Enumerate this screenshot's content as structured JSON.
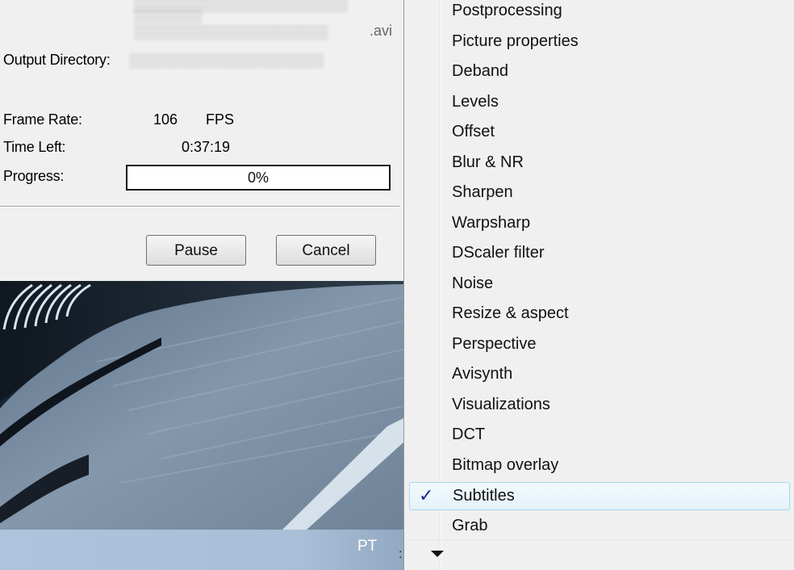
{
  "dialog": {
    "input_file_ext": ".avi",
    "output_directory_label": "Output Directory:",
    "frame_rate_label": "Frame Rate:",
    "frame_rate_value": "106",
    "frame_rate_unit": "FPS",
    "time_left_label": "Time Left:",
    "time_left_value": "0:37:19",
    "progress_label": "Progress:",
    "progress_text": "0%",
    "progress_fraction": 0,
    "pause_label": "Pause",
    "cancel_label": "Cancel"
  },
  "taskbar": {
    "language": "PT"
  },
  "menu": {
    "items": [
      {
        "label": "Postprocessing",
        "checked": false
      },
      {
        "label": "Picture properties",
        "checked": false
      },
      {
        "label": "Deband",
        "checked": false
      },
      {
        "label": "Levels",
        "checked": false
      },
      {
        "label": "Offset",
        "checked": false
      },
      {
        "label": "Blur & NR",
        "checked": false
      },
      {
        "label": "Sharpen",
        "checked": false
      },
      {
        "label": "Warpsharp",
        "checked": false
      },
      {
        "label": "DScaler filter",
        "checked": false
      },
      {
        "label": "Noise",
        "checked": false
      },
      {
        "label": "Resize & aspect",
        "checked": false
      },
      {
        "label": "Perspective",
        "checked": false
      },
      {
        "label": "Avisynth",
        "checked": false
      },
      {
        "label": "Visualizations",
        "checked": false
      },
      {
        "label": "DCT",
        "checked": false
      },
      {
        "label": "Bitmap overlay",
        "checked": false
      },
      {
        "label": "Subtitles",
        "checked": true
      },
      {
        "label": "Grab",
        "checked": false
      }
    ],
    "check_glyph": "✓",
    "scroll_icon": "scroll-down-arrow-icon"
  },
  "colors": {
    "dialog_bg": "#f0f0f0",
    "menu_bg": "#f0f0f0",
    "selection_border": "#a8d8f0",
    "check_color": "#152a86",
    "taskbar": "#aec4dc"
  }
}
